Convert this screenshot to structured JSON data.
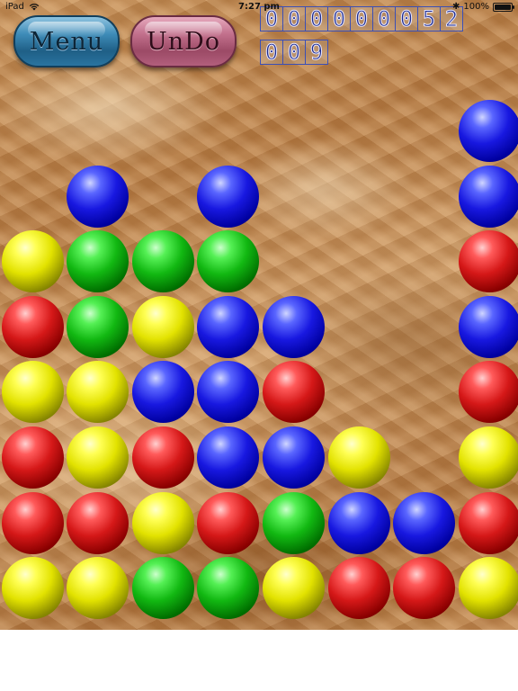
{
  "status_bar": {
    "device": "iPad",
    "time": "7:27 pm",
    "battery": "100%",
    "icons": [
      "wifi-icon",
      "bluetooth-icon",
      "battery-icon"
    ]
  },
  "buttons": {
    "menu_label": "Menu",
    "undo_label": "UnDo"
  },
  "score": {
    "digits": [
      "0",
      "0",
      "0",
      "0",
      "0",
      "0",
      "0",
      "5",
      "2"
    ]
  },
  "moves": {
    "digits": [
      "0",
      "0",
      "9"
    ]
  },
  "colors": {
    "red": "#d51818",
    "blue": "#1818e0",
    "green": "#12b812",
    "yellow": "#e2e200",
    "board": "#c48a52"
  },
  "board": {
    "columns": 8,
    "rows": 8,
    "cells_top_to_bottom": [
      [
        null,
        null,
        null,
        null,
        null,
        null,
        null,
        "blue"
      ],
      [
        null,
        "blue",
        null,
        "blue",
        null,
        null,
        null,
        "blue"
      ],
      [
        "yellow",
        "green",
        "green",
        "green",
        null,
        null,
        null,
        "red"
      ],
      [
        "red",
        "green",
        "yellow",
        "blue",
        "blue",
        null,
        null,
        "blue"
      ],
      [
        "yellow",
        "yellow",
        "blue",
        "blue",
        "red",
        null,
        null,
        "red"
      ],
      [
        "red",
        "yellow",
        "red",
        "blue",
        "blue",
        "yellow",
        null,
        "yellow"
      ],
      [
        "red",
        "red",
        "yellow",
        "red",
        "green",
        "blue",
        "blue",
        "red"
      ],
      [
        "yellow",
        "yellow",
        "green",
        "green",
        "yellow",
        "red",
        "red",
        "yellow"
      ]
    ]
  }
}
